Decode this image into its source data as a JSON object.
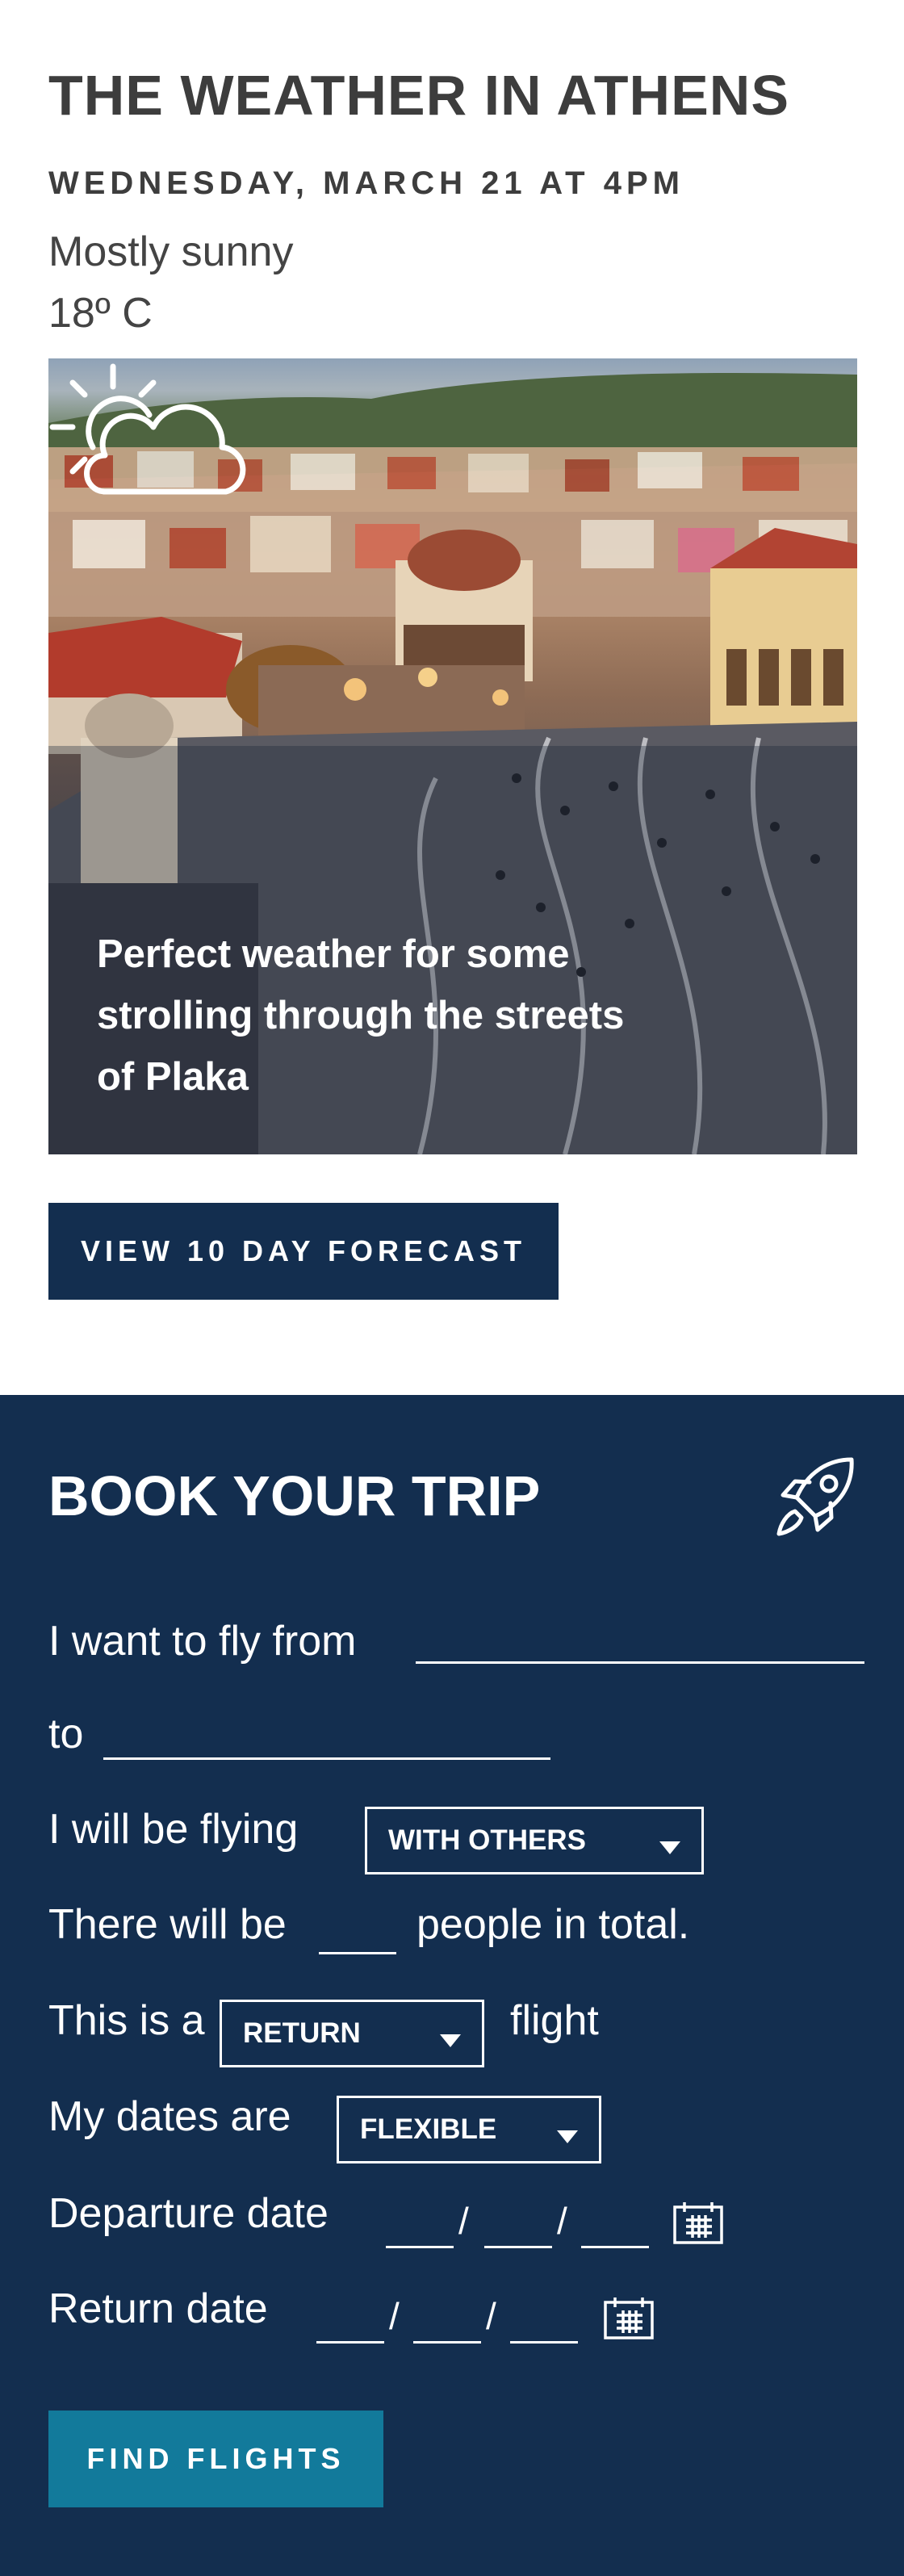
{
  "weather": {
    "title": "THE WEATHER IN ATHENS",
    "date": "WEDNESDAY, MARCH 21 AT 4PM",
    "condition": "Mostly sunny",
    "temperature": "18º C",
    "caption": "Perfect weather for some strolling through the streets of Plaka",
    "icon": "partly-sunny-icon",
    "forecast_button": "VIEW 10 DAY FORECAST"
  },
  "booking": {
    "title": "BOOK YOUR TRIP",
    "icon": "rocket-icon",
    "fly_from_label": "I want to fly from",
    "fly_from_value": "",
    "to_label": "to",
    "to_value": "",
    "flying_label": "I will be flying",
    "flying_option": "WITH OTHERS",
    "there_will_be": "There will be",
    "people_value": "",
    "people_suffix": "people in total.",
    "this_is_a": "This is a",
    "trip_type": "RETURN",
    "flight_label": "flight",
    "dates_label": "My dates are",
    "dates_option": "FLEXIBLE",
    "departure_label": "Departure date",
    "return_label": "Return date",
    "date_separator": "/",
    "calendar_icon": "calendar-icon",
    "find_button": "FIND FLIGHTS"
  },
  "colors": {
    "navy": "#132e4f",
    "teal": "#127a9b",
    "text_dark": "#3d3d3d"
  }
}
